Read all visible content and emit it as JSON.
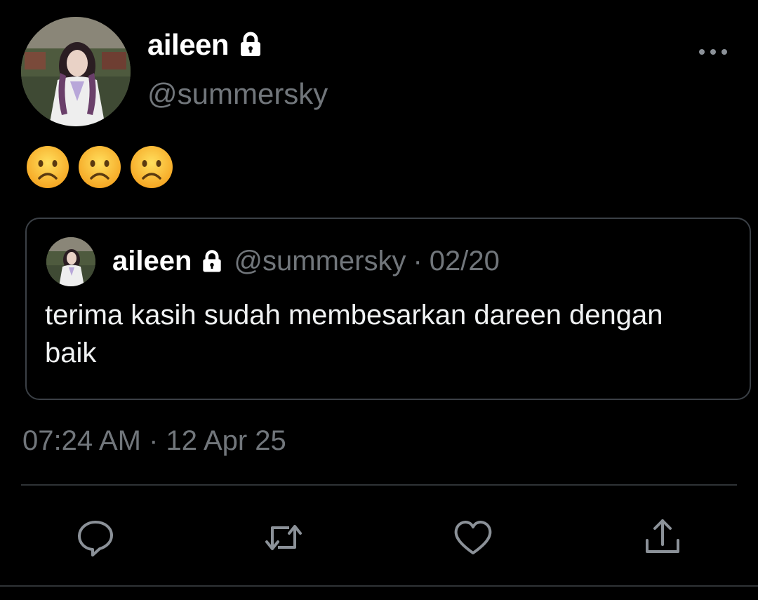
{
  "tweet": {
    "author": {
      "display_name": "aileen",
      "handle": "@summersky",
      "protected_icon": "lock-icon",
      "avatar": "avatar-image"
    },
    "more_icon": "more-horizontal-icon",
    "emojis": [
      "☹️",
      "☹️",
      "☹️"
    ],
    "quoted": {
      "display_name": "aileen",
      "handle": "@summersky",
      "separator": "·",
      "date": "02/20",
      "text": "terima kasih sudah membesarkan dareen dengan baik"
    },
    "timestamp": "07:24 AM · 12 Apr 25",
    "actions": [
      {
        "name": "reply",
        "icon": "reply-icon"
      },
      {
        "name": "retweet",
        "icon": "retweet-icon"
      },
      {
        "name": "like",
        "icon": "heart-icon"
      },
      {
        "name": "share",
        "icon": "share-icon"
      }
    ]
  },
  "colors": {
    "background": "#000000",
    "primary_text": "#ffffff",
    "secondary_text": "#71767b",
    "border": "#3b4046",
    "icon": "#8b9198"
  }
}
